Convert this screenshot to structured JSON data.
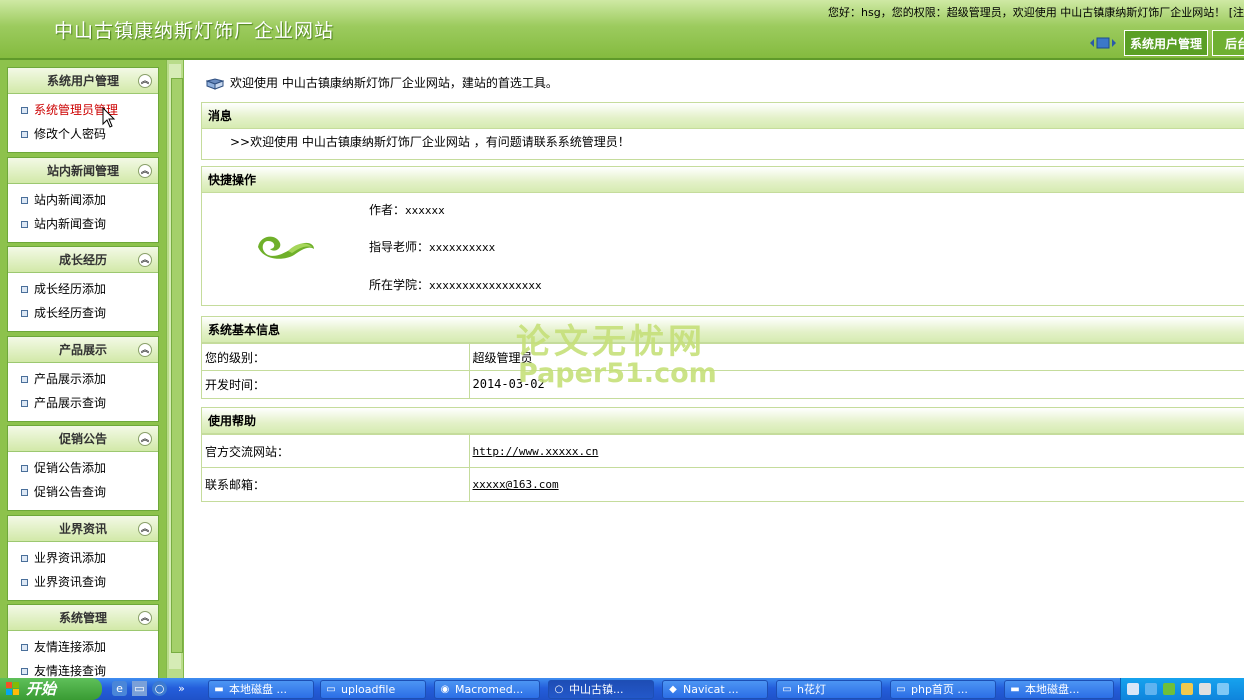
{
  "header": {
    "site_title": "中山古镇康纳斯灯饰厂企业网站",
    "welcome": "您好：hsg，您的权限：超级管理员，欢迎使用  中山古镇康纳斯灯饰厂企业网站！  [注",
    "tabs": [
      "系统用户管理",
      "后台"
    ]
  },
  "sidebar": {
    "groups": [
      {
        "title": "系统用户管理",
        "items": [
          "系统管理员管理",
          "修改个人密码"
        ]
      },
      {
        "title": "站内新闻管理",
        "items": [
          "站内新闻添加",
          "站内新闻查询"
        ]
      },
      {
        "title": "成长经历",
        "items": [
          "成长经历添加",
          "成长经历查询"
        ]
      },
      {
        "title": "产品展示",
        "items": [
          "产品展示添加",
          "产品展示查询"
        ]
      },
      {
        "title": "促销公告",
        "items": [
          "促销公告添加",
          "促销公告查询"
        ]
      },
      {
        "title": "业界资讯",
        "items": [
          "业界资讯添加",
          "业界资讯查询"
        ]
      },
      {
        "title": "系统管理",
        "items": [
          "友情连接添加",
          "友情连接查询"
        ]
      }
    ],
    "toggle_glyph": "︽",
    "active_item": "系统管理员管理"
  },
  "main": {
    "intro": "欢迎使用  中山古镇康纳斯灯饰厂企业网站，建站的首选工具。",
    "message": {
      "title": "消息",
      "text": ">>欢迎使用  中山古镇康纳斯灯饰厂企业网站  ，有问题请联系系统管理员！"
    },
    "quick": {
      "title": "快捷操作",
      "author_label": "作者：",
      "author": "xxxxxx",
      "teacher_label": "指导老师：",
      "teacher": "xxxxxxxxxx",
      "college_label": "所在学院：",
      "college": "xxxxxxxxxxxxxxxxx"
    },
    "sysinfo": {
      "title": "系统基本信息",
      "level_label": "您的级别：",
      "level": "超级管理员",
      "date_label": "开发时间：",
      "date": "2014-03-02"
    },
    "help": {
      "title": "使用帮助",
      "site_label": "官方交流网站：",
      "site": "http://www.xxxxx.cn",
      "email_label": "联系邮箱：",
      "email": "xxxxx@163.com"
    }
  },
  "watermark": {
    "line1": "论文无忧网",
    "line2": "Paper51.com"
  },
  "taskbar": {
    "start": "开始",
    "chevron": "»",
    "tasks": [
      "本地磁盘 ...",
      "uploadfile",
      "Macromed...",
      "中山古镇...",
      "Navicat ...",
      "h花灯",
      "php首页 ...",
      "本地磁盘..."
    ]
  },
  "colors": {
    "accent": "#8dc24c",
    "header": "#9ccb5e",
    "taskbar": "#245edb",
    "start": "#399b33"
  }
}
